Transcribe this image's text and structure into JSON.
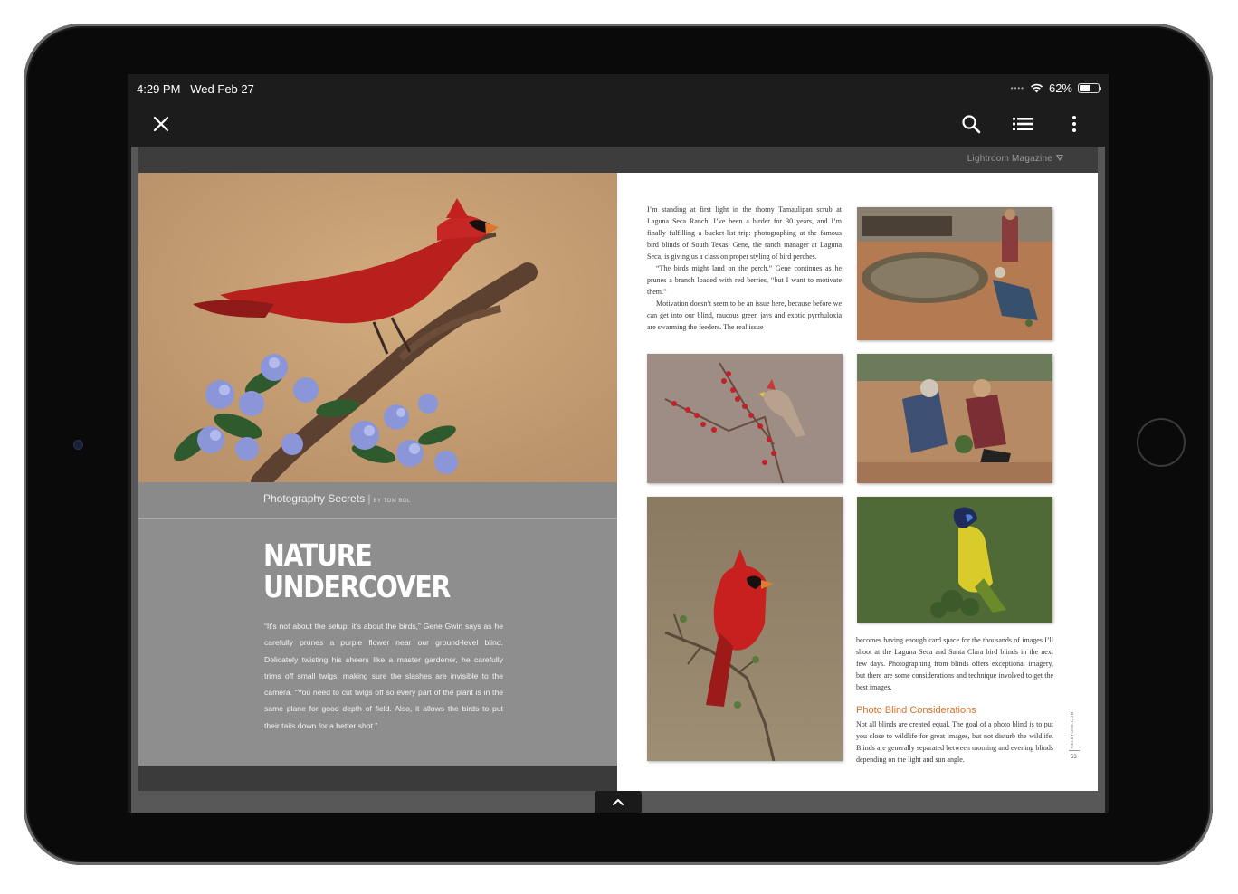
{
  "status_bar": {
    "time": "4:29 PM",
    "date": "Wed Feb 27",
    "battery": "62%",
    "battery_level": 0.62
  },
  "toolbar": {
    "close_icon": "close-icon",
    "search_icon": "search-icon",
    "list_icon": "list-icon",
    "more_icon": "more-vertical-icon"
  },
  "magazine": {
    "title": "Lightroom Magazine"
  },
  "left_page": {
    "section": "Photography Secrets",
    "byline": "BY TOM BOL",
    "headline_line1": "NATURE",
    "headline_line2": "UNDERCOVER",
    "intro": "“It’s not about the setup; it’s about the birds,” Gene Gwin says as he carefully prunes a purple flower near our ground-level blind. Delicately twisting his sheers like a master gardener, he carefully trims off small twigs, making sure the slashes are invisible to the camera. “You need to cut twigs off so every part of the plant is in the same plane for good depth of field. Also, it allows the birds to put their tails down for a better shot.”"
  },
  "right_page": {
    "para1": "I’m standing at first light in the thorny Tamaulipan scrub at Laguna Seca Ranch. I’ve been a birder for 30 years, and I’m finally fulfilling a bucket-list trip: photographing at the famous bird blinds of South Texas. Gene, the ranch manager at Laguna Seca, is giving us a class on proper styling of bird perches.",
    "para2": "“The birds might land on the perch,” Gene continues as he prunes a branch loaded with red berries, “but I want to motivate them.”",
    "para3": "Motivation doesn’t seem to be an issue here, because before we can get into our blind, raucous green jays and exotic pyrrhuloxia are swarming the feeders. The real issue",
    "para4": "becomes having enough card space for the thousands of images I’ll shoot at the Laguna Seca and Santa Clara bird blinds in the next few days. Photographing from blinds offers exceptional imagery, but there are some considerations and technique involved to get the best images.",
    "subhead": "Photo Blind Considerations",
    "para5": "Not all blinds are created equal. The goal of a photo blind is to put you close to wildlife for great images, but not disturb the wildlife. Blinds are generally separated between morning and evening blinds depending on the light and sun angle.",
    "side_url": "KELBYONE.COM",
    "page_number": "53"
  },
  "colors": {
    "accent_subhead": "#d4722a",
    "toolbar_bg": "#1c1c1c",
    "left_page_bg": "#8e8e8e"
  }
}
